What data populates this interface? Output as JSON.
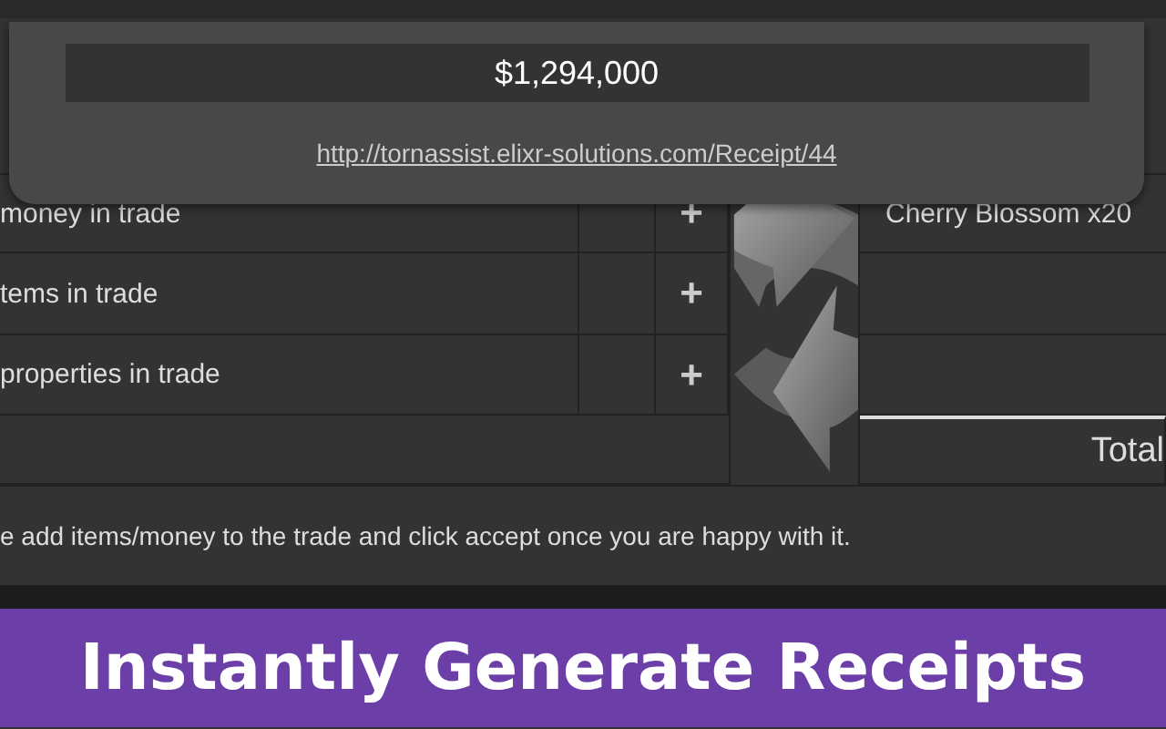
{
  "popup": {
    "amount": "$1,294,000",
    "link": "http://tornassist.elixr-solutions.com/Receipt/44"
  },
  "trade_rows": [
    {
      "label": "money in trade",
      "add": "+"
    },
    {
      "label": "tems in trade",
      "add": "+"
    },
    {
      "label": "properties in trade",
      "add": "+"
    }
  ],
  "other_side": {
    "items": [
      "Cherry Blossom x20"
    ],
    "total": "Total"
  },
  "info": "e add items/money to the trade and click accept once you are happy with it.",
  "banner": {
    "title": "Instantly Generate Receipts"
  }
}
